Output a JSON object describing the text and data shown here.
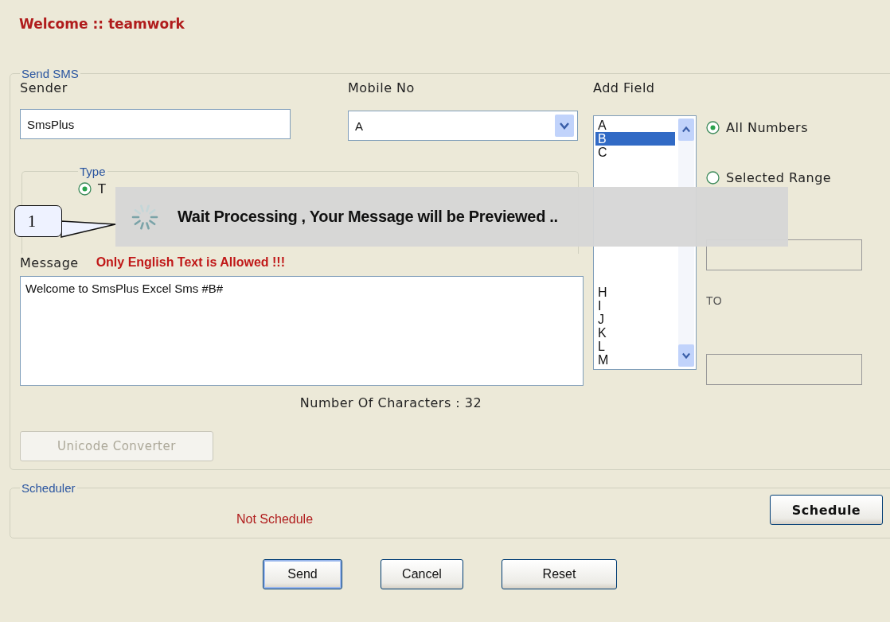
{
  "header": {
    "title": "Welcome :: teamwork"
  },
  "send_sms": {
    "legend": "Send SMS",
    "sender": {
      "label": "Sender",
      "value": "SmsPlus"
    },
    "mobile_no": {
      "label": "Mobile No",
      "value": "A"
    },
    "add_field": {
      "label": "Add Field",
      "items_top": [
        {
          "label": "A",
          "selected": false
        },
        {
          "label": "B",
          "selected": true
        },
        {
          "label": "C",
          "selected": false
        }
      ],
      "items_bottom": [
        {
          "label": "H",
          "selected": false
        },
        {
          "label": "I",
          "selected": false
        },
        {
          "label": "J",
          "selected": false
        },
        {
          "label": "K",
          "selected": false
        },
        {
          "label": "L",
          "selected": false
        },
        {
          "label": "M",
          "selected": false
        }
      ]
    },
    "range_options": [
      {
        "label": "All Numbers",
        "selected": true
      },
      {
        "label": "Selected Range",
        "selected": false
      }
    ],
    "range_to_label": "TO",
    "type": {
      "legend": "Type",
      "options": [
        {
          "label": "T",
          "selected": true
        }
      ]
    },
    "message": {
      "label": "Message",
      "warning": "Only English Text is Allowed !!!",
      "value": "Welcome to SmsPlus Excel Sms #B#"
    },
    "character_count": "Number Of Characters : 32",
    "unicode_button": {
      "label": "Unicode Converter",
      "disabled": true
    }
  },
  "scheduler": {
    "legend": "Scheduler",
    "status": "Not Schedule",
    "button": "Schedule"
  },
  "buttons": [
    {
      "label": "Send",
      "focused": true
    },
    {
      "label": "Cancel",
      "focused": false
    },
    {
      "label": "Reset",
      "focused": false
    }
  ],
  "overlay": {
    "message": "Wait Processing , Your Message will be Previewed .."
  },
  "callout": {
    "label": "1"
  }
}
